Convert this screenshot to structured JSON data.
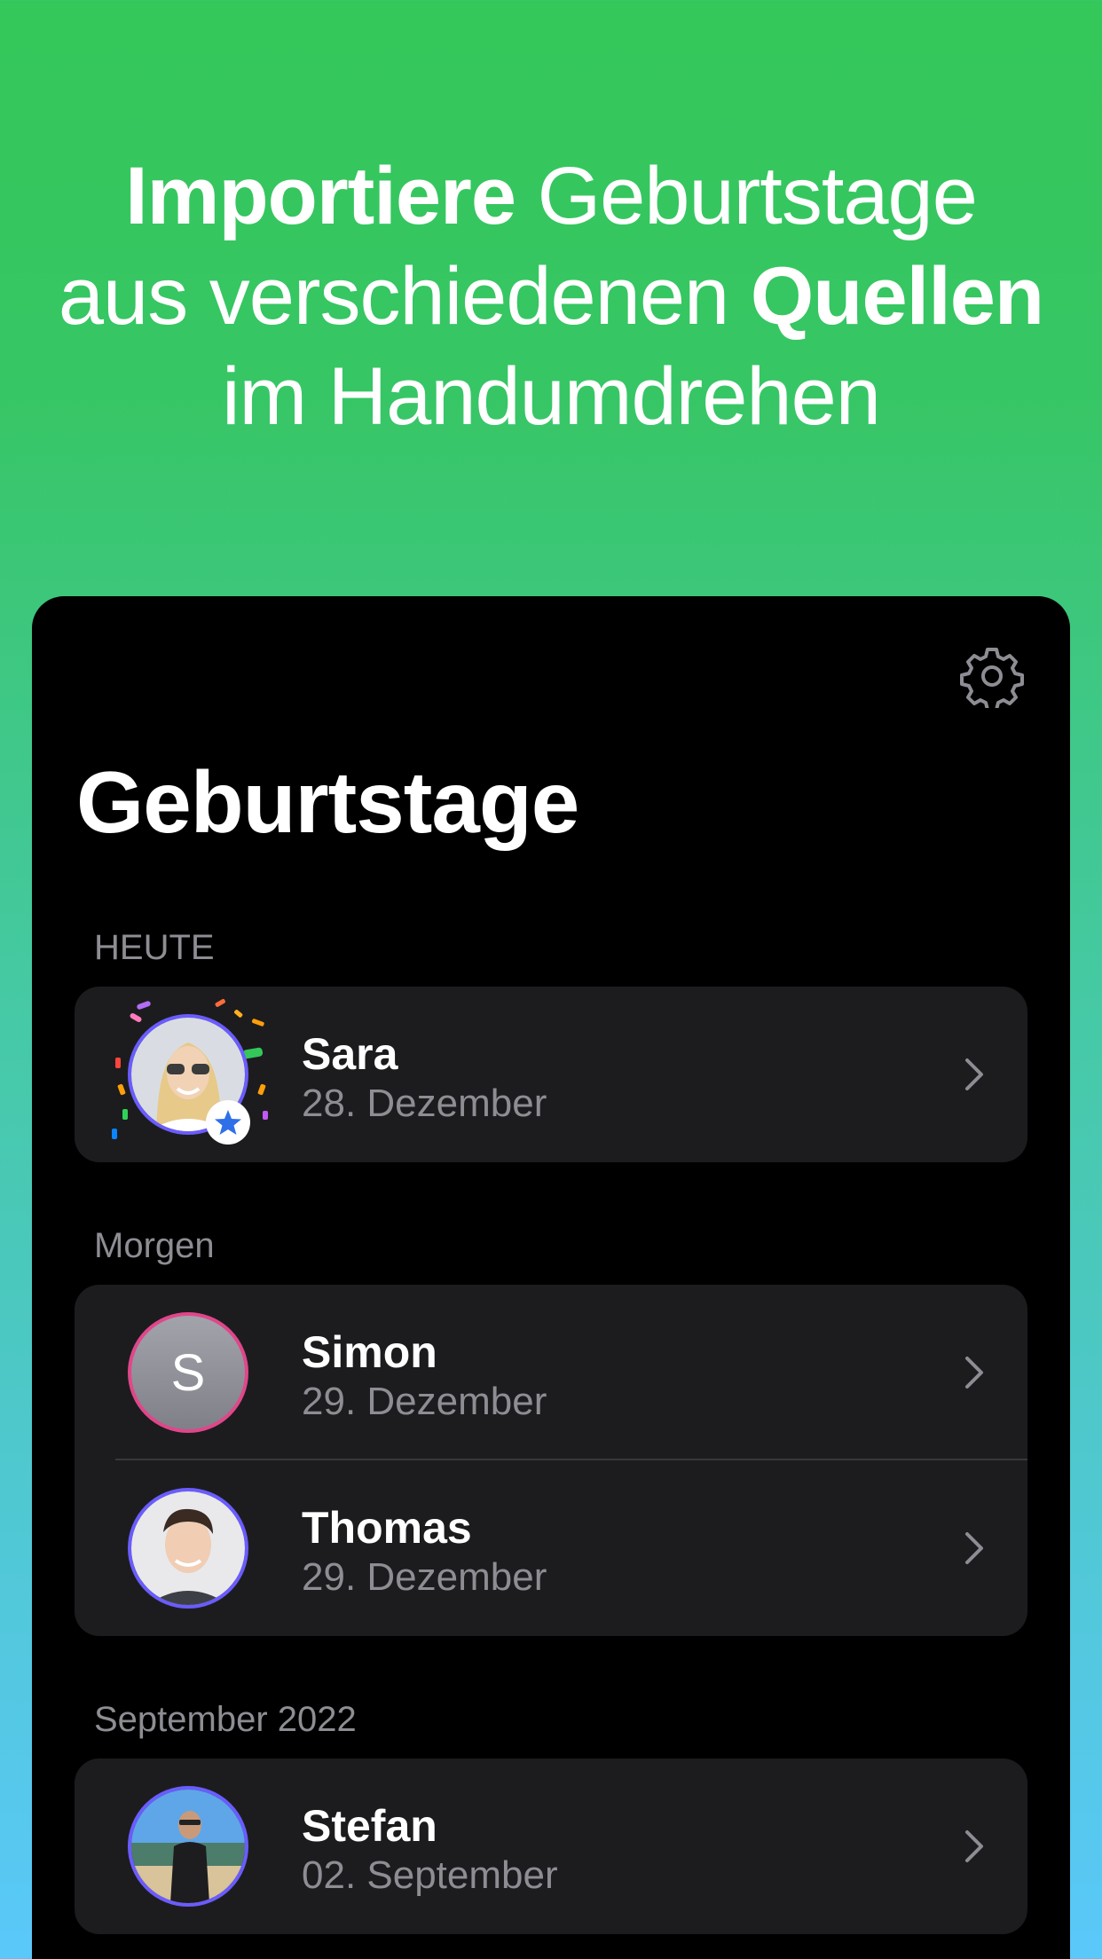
{
  "headline": {
    "line1_bold": "Importiere",
    "line1_regular": " Geburtstage",
    "line2_regular": "aus verschiedenen ",
    "line2_bold": "Quellen",
    "line3_regular": "im Handumdrehen"
  },
  "app": {
    "title": "Geburtstage",
    "settings_icon": "gear-icon"
  },
  "sections": [
    {
      "label": "HEUTE",
      "items": [
        {
          "name": "Sara",
          "date": "28. Dezember",
          "avatar": "photo",
          "favorite": true,
          "celebration": true
        }
      ]
    },
    {
      "label": "Morgen",
      "items": [
        {
          "name": "Simon",
          "date": "29. Dezember",
          "avatar": "initial",
          "initial": "S"
        },
        {
          "name": "Thomas",
          "date": "29. Dezember",
          "avatar": "photo"
        }
      ]
    },
    {
      "label": "September 2022",
      "items": [
        {
          "name": "Stefan",
          "date": "02. September",
          "avatar": "photo"
        }
      ]
    }
  ],
  "colors": {
    "gradient_top": "#34c759",
    "gradient_bottom": "#5ac8fa",
    "card_bg": "#1c1c1e",
    "secondary_text": "#8d8d93",
    "ring_purple": "#6a5cff",
    "ring_pink": "#e0468a",
    "favorite_star": "#2f6fe8"
  }
}
